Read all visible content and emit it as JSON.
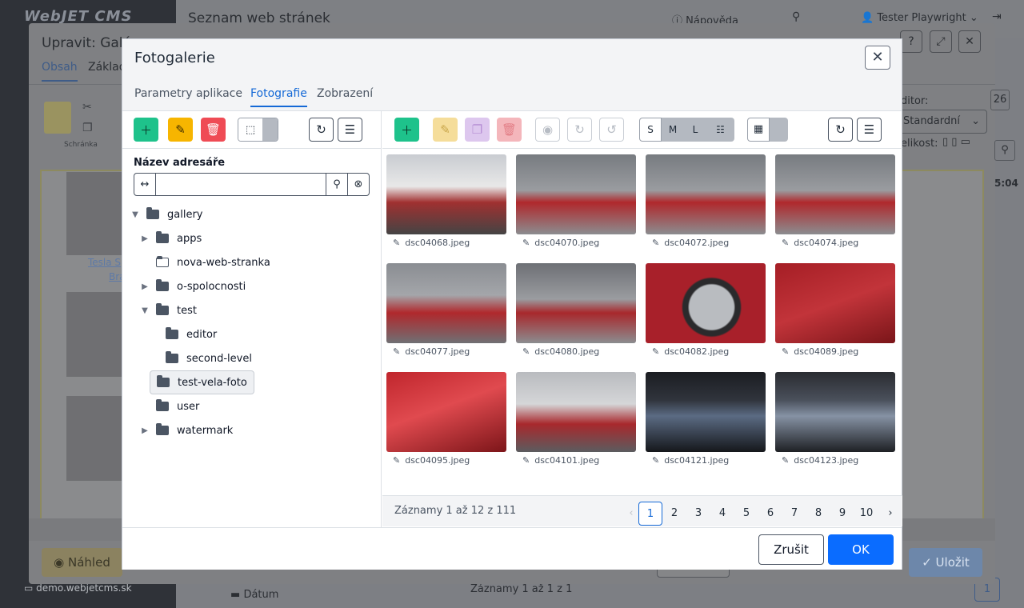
{
  "background": {
    "logo": "WebJET CMS",
    "page_title": "Seznam web stránek",
    "help": "Nápověda",
    "user": "Tester Playwright",
    "domain": "demo.webjetcms.sk",
    "footer_folder": "Dátum",
    "footer_records": "Záznamy 1 až 1 z 1"
  },
  "outer": {
    "title": "Upravit: Galé",
    "tab_content": "Obsah",
    "tab_basic": "Základ",
    "clipboard": "Schránka",
    "editor_label": "ditor:",
    "editor_value": "Standardní",
    "size_label": "elikost:",
    "time": "5:04",
    "num": "26",
    "caption": "Tesla S",
    "caption2": "Bra",
    "preview": "Náhled",
    "save": "Uložit"
  },
  "dialog": {
    "title": "Fotogalerie",
    "tabs": [
      "Parametry aplikace",
      "Fotografie",
      "Zobrazení"
    ],
    "dir_label": "Název adresáře",
    "size_buttons": [
      "S",
      "M",
      "L"
    ],
    "tree": [
      {
        "name": "gallery"
      },
      {
        "name": "apps"
      },
      {
        "name": "nova-web-stranka"
      },
      {
        "name": "o-spolocnosti"
      },
      {
        "name": "test"
      },
      {
        "name": "editor"
      },
      {
        "name": "second-level"
      },
      {
        "name": "test-vela-foto"
      },
      {
        "name": "user"
      },
      {
        "name": "watermark"
      }
    ],
    "photos": [
      "dsc04068.jpeg",
      "dsc04070.jpeg",
      "dsc04072.jpeg",
      "dsc04074.jpeg",
      "dsc04077.jpeg",
      "dsc04080.jpeg",
      "dsc04082.jpeg",
      "dsc04089.jpeg",
      "dsc04095.jpeg",
      "dsc04101.jpeg",
      "dsc04121.jpeg",
      "dsc04123.jpeg"
    ],
    "records": "Záznamy 1 až 12 z 111",
    "pages": [
      "1",
      "2",
      "3",
      "4",
      "5",
      "6",
      "7",
      "8",
      "9",
      "10"
    ],
    "cancel": "Zrušit",
    "ok": "OK"
  },
  "colors": {
    "accent": "#1569d6",
    "ok_button": "#0a6cff",
    "add_button": "#1ec28b",
    "edit_button": "#f7b500",
    "delete_button": "#ef4b55"
  }
}
